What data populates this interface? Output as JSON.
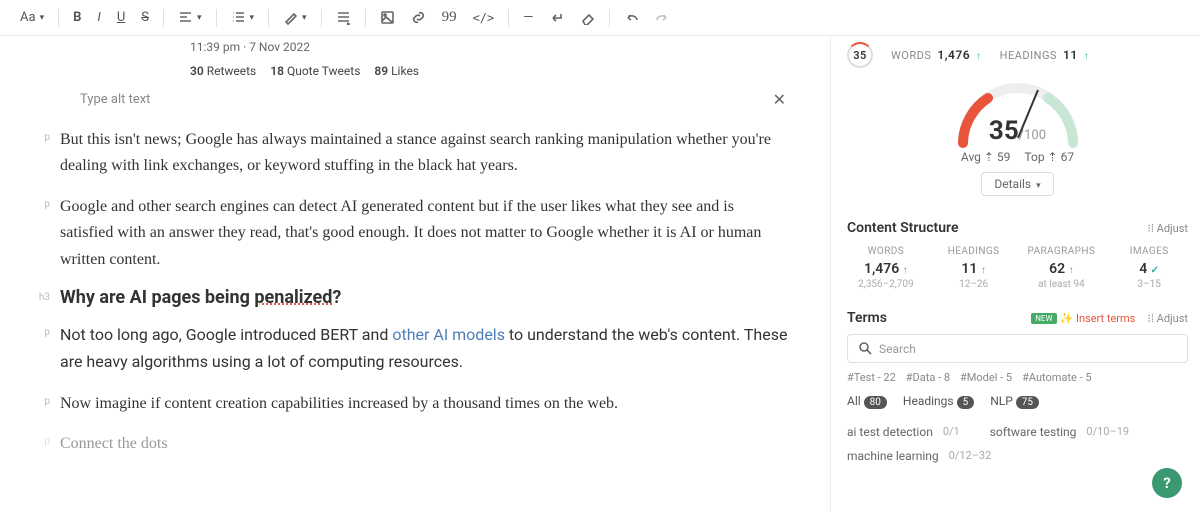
{
  "toolbar": {
    "font": "Aa"
  },
  "embed": {
    "time": "11:39 pm · 7 Nov 2022",
    "retweets": "30",
    "rt_label": "Retweets",
    "quotes": "18",
    "q_label": "Quote Tweets",
    "likes": "89",
    "l_label": "Likes"
  },
  "alt": {
    "placeholder": "Type alt text"
  },
  "blocks": [
    {
      "tag": "p",
      "text": "But this isn't news; Google has always maintained a stance against search ranking manipulation whether you're dealing with link exchanges, or keyword stuffing in the black hat years."
    },
    {
      "tag": "p",
      "text": "Google and other search engines can detect AI generated content but if the user likes what they see and is satisfied with an answer they read, that's good enough. It does not matter to Google whether it is AI or human written content."
    },
    {
      "tag": "h3",
      "text": "Why are AI pages being ",
      "u": "penalized",
      "after": "?"
    },
    {
      "tag": "p",
      "pre": "Not too long ago, Google introduced BERT and ",
      "link": "other AI models",
      "post": " to understand the web's content. These are heavy algorithms using a lot of computing resources."
    },
    {
      "tag": "p",
      "text": "Now imagine if content creation capabilities increased by a thousand times on the web."
    },
    {
      "tag": "p",
      "text": "Connect the dots"
    }
  ],
  "top": {
    "score": "35",
    "words_lbl": "WORDS",
    "words": "1,476",
    "head_lbl": "HEADINGS",
    "head": "11"
  },
  "gauge": {
    "score": "35",
    "max": "/100",
    "avg": "Avg ⇡ 59",
    "top": "Top ⇡ 67",
    "details": "Details"
  },
  "cs": {
    "title": "Content Structure",
    "adjust": "⁝⁞ Adjust",
    "cols": [
      {
        "lbl": "WORDS",
        "val": "1,476",
        "mark": "↑",
        "range": "2,356–2,709"
      },
      {
        "lbl": "HEADINGS",
        "val": "11",
        "mark": "↑",
        "range": "12–26"
      },
      {
        "lbl": "PARAGRAPHS",
        "val": "62",
        "mark": "↑",
        "range": "at least 94"
      },
      {
        "lbl": "IMAGES",
        "val": "4",
        "mark": "✓",
        "range": "3–15"
      }
    ]
  },
  "terms": {
    "title": "Terms",
    "new": "NEW",
    "insert": "✨ Insert terms",
    "adjust": "⁝⁞ Adjust",
    "search": "Search",
    "tags": [
      "#Test - 22",
      "#Data - 8",
      "#Model - 5",
      "#Automate - 5"
    ],
    "filters": [
      {
        "l": "All",
        "c": "80"
      },
      {
        "l": "Headings",
        "c": "5"
      },
      {
        "l": "NLP",
        "c": "75"
      }
    ],
    "items": [
      [
        {
          "t": "ai test detection",
          "c": "0/1"
        },
        {
          "t": "software testing",
          "c": "0/10–19"
        }
      ],
      [
        {
          "t": "machine learning",
          "c": "0/12–32"
        }
      ]
    ]
  }
}
